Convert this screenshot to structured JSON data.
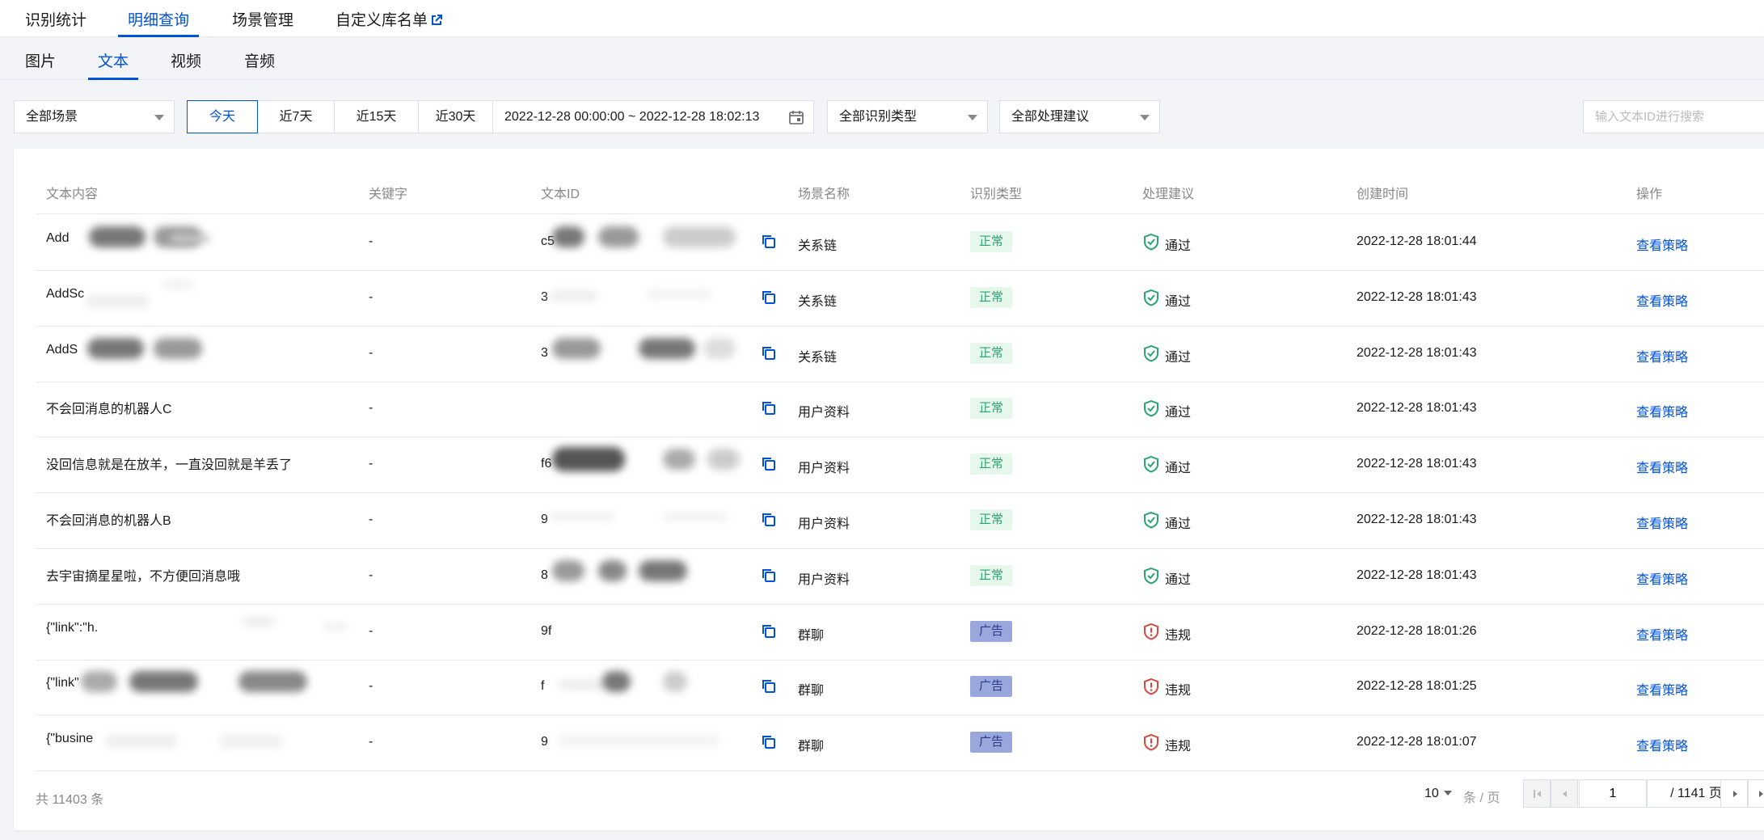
{
  "top_tabs": [
    "识别统计",
    "明细查询",
    "场景管理",
    "自定义库名单"
  ],
  "sub_tabs": [
    "图片",
    "文本",
    "视频",
    "音频"
  ],
  "filters": {
    "scene": "全部场景",
    "date_buttons": [
      "今天",
      "近7天",
      "近15天",
      "近30天"
    ],
    "date_range": "2022-12-28 00:00:00  ~ 2022-12-28 18:02:13",
    "recog_type": "全部识别类型",
    "suggestion": "全部处理建议",
    "search_placeholder": "输入文本ID进行搜索"
  },
  "table": {
    "columns": [
      "文本内容",
      "关键字",
      "文本ID",
      "场景名称",
      "识别类型",
      "处理建议",
      "创建时间",
      "操作"
    ],
    "rows": [
      {
        "content": "Add",
        "keyword": "-",
        "id": "c5",
        "scene": "关系链",
        "type": "正常",
        "suggestion": "通过",
        "time": "2022-12-28 18:01:44",
        "action": "查看策略"
      },
      {
        "content": "AddSc",
        "keyword": "-",
        "id": "3",
        "scene": "关系链",
        "type": "正常",
        "suggestion": "通过",
        "time": "2022-12-28 18:01:43",
        "action": "查看策略"
      },
      {
        "content": "AddS",
        "keyword": "-",
        "id": "3",
        "scene": "关系链",
        "type": "正常",
        "suggestion": "通过",
        "time": "2022-12-28 18:01:43",
        "action": "查看策略"
      },
      {
        "content": "不会回消息的机器人C",
        "keyword": "-",
        "id": "",
        "scene": "用户资料",
        "type": "正常",
        "suggestion": "通过",
        "time": "2022-12-28 18:01:43",
        "action": "查看策略"
      },
      {
        "content": "没回信息就是在放羊，一直没回就是羊丢了",
        "keyword": "-",
        "id": "f6",
        "scene": "用户资料",
        "type": "正常",
        "suggestion": "通过",
        "time": "2022-12-28 18:01:43",
        "action": "查看策略"
      },
      {
        "content": "不会回消息的机器人B",
        "keyword": "-",
        "id": "9",
        "scene": "用户资料",
        "type": "正常",
        "suggestion": "通过",
        "time": "2022-12-28 18:01:43",
        "action": "查看策略"
      },
      {
        "content": "去宇宙摘星星啦，不方便回消息哦",
        "keyword": "-",
        "id": "8",
        "scene": "用户资料",
        "type": "正常",
        "suggestion": "通过",
        "time": "2022-12-28 18:01:43",
        "action": "查看策略"
      },
      {
        "content": "{\"link\":\"h.",
        "keyword": "-",
        "id": "9f",
        "scene": "群聊",
        "type": "广告",
        "suggestion": "违规",
        "time": "2022-12-28 18:01:26",
        "action": "查看策略"
      },
      {
        "content": "{\"link\"",
        "keyword": "-",
        "id": "f",
        "scene": "群聊",
        "type": "广告",
        "suggestion": "违规",
        "time": "2022-12-28 18:01:25",
        "action": "查看策略"
      },
      {
        "content": "{\"busine",
        "keyword": "-",
        "id": "9",
        "scene": "群聊",
        "type": "广告",
        "suggestion": "违规",
        "time": "2022-12-28 18:01:07",
        "action": "查看策略"
      }
    ]
  },
  "footer": {
    "total": "共  11403  条",
    "page_size": "10",
    "page_size_unit": "条 / 页",
    "page_current": "1",
    "page_total": "/ 1141 页"
  },
  "colors": {
    "accent": "#0052d9",
    "ok": "#2ba471",
    "danger": "#d54941"
  }
}
